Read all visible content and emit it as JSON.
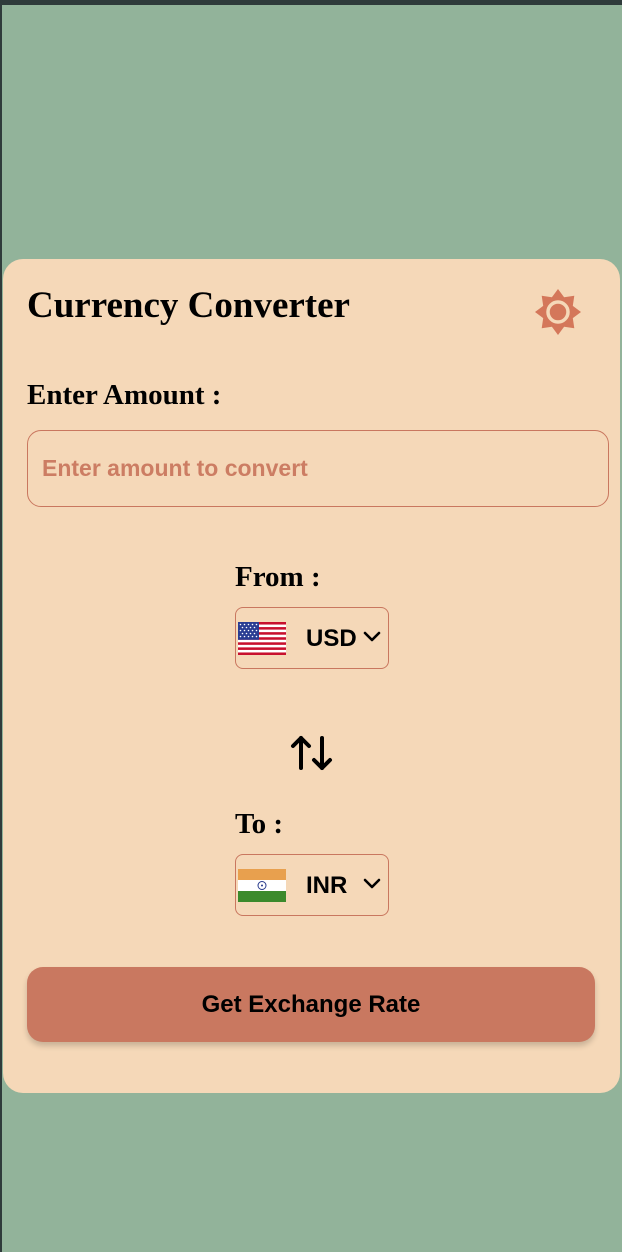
{
  "header": {
    "title": "Currency Converter"
  },
  "icons": {
    "settings": "gear-icon",
    "swap": "swap-arrows-icon",
    "dropdown": "chevron-down-icon"
  },
  "amount": {
    "label": "Enter Amount :",
    "placeholder": "Enter amount to convert",
    "value": ""
  },
  "from": {
    "label": "From :",
    "currency": "USD",
    "flag": "us-flag"
  },
  "to": {
    "label": "To :",
    "currency": "INR",
    "flag": "india-flag"
  },
  "action": {
    "button_label": "Get Exchange Rate"
  },
  "colors": {
    "page_background": "#92b39a",
    "card_background": "#f5d8b8",
    "accent": "#c97860",
    "border": "#c9775f",
    "text": "#000000"
  }
}
